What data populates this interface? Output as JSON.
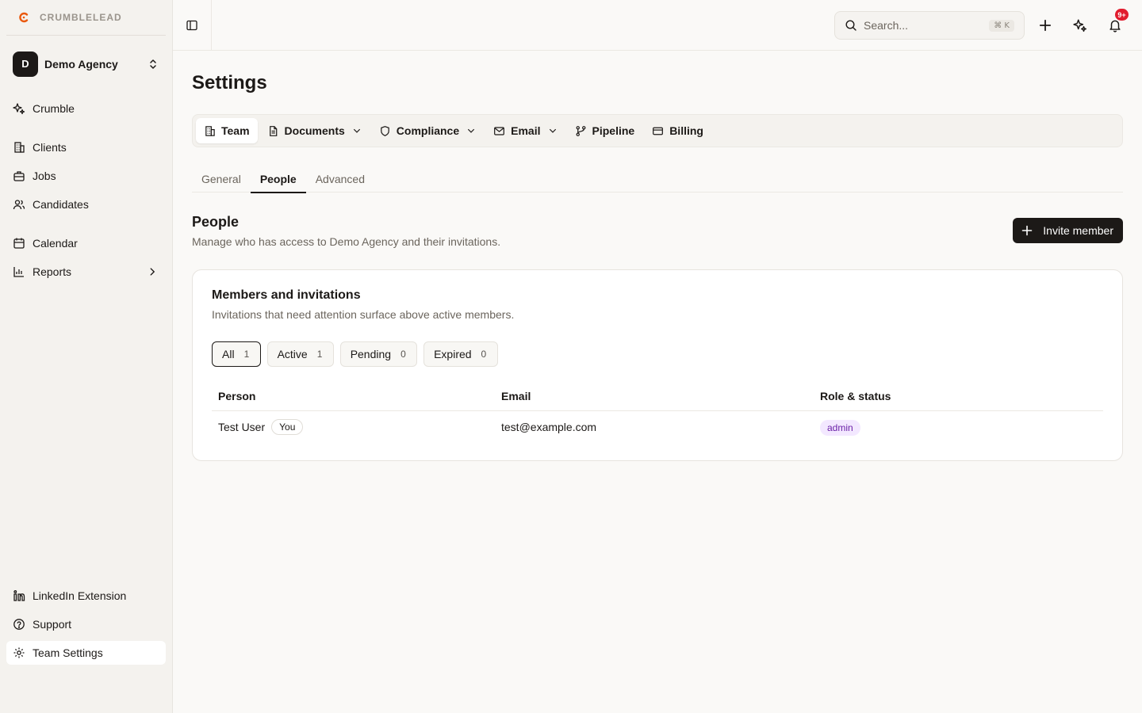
{
  "brand": {
    "name": "CRUMBLELEAD",
    "accent": "#ea580c"
  },
  "workspace": {
    "initial": "D",
    "name": "Demo Agency"
  },
  "sidebar": {
    "items": [
      {
        "label": "Crumble",
        "icon": "sparkles-icon"
      },
      {
        "label": "Clients",
        "icon": "building-icon"
      },
      {
        "label": "Jobs",
        "icon": "briefcase-icon"
      },
      {
        "label": "Candidates",
        "icon": "users-icon"
      },
      {
        "label": "Calendar",
        "icon": "calendar-icon"
      },
      {
        "label": "Reports",
        "icon": "bar-chart-icon"
      }
    ],
    "footer": [
      {
        "label": "LinkedIn Extension",
        "icon": "linkedin-icon"
      },
      {
        "label": "Support",
        "icon": "help-circle-icon"
      },
      {
        "label": "Team Settings",
        "icon": "gear-icon"
      }
    ]
  },
  "topbar": {
    "search_placeholder": "Search...",
    "shortcut": "⌘ K",
    "notif_count": "9+"
  },
  "page": {
    "title": "Settings"
  },
  "section_tabs": [
    {
      "label": "Team",
      "active": true
    },
    {
      "label": "Documents",
      "dropdown": true
    },
    {
      "label": "Compliance",
      "dropdown": true
    },
    {
      "label": "Email",
      "dropdown": true
    },
    {
      "label": "Pipeline"
    },
    {
      "label": "Billing"
    }
  ],
  "sub_tabs": [
    "General",
    "People",
    "Advanced"
  ],
  "people": {
    "title": "People",
    "description": "Manage who has access to Demo Agency and their invitations.",
    "invite_label": "Invite member"
  },
  "card": {
    "title": "Members and invitations",
    "description": "Invitations that need attention surface above active members.",
    "filters": [
      {
        "label": "All",
        "count": "1"
      },
      {
        "label": "Active",
        "count": "1"
      },
      {
        "label": "Pending",
        "count": "0"
      },
      {
        "label": "Expired",
        "count": "0"
      }
    ],
    "columns": [
      "Person",
      "Email",
      "Role & status"
    ],
    "rows": [
      {
        "name": "Test User",
        "badge": "You",
        "email": "test@example.com",
        "role": "admin"
      }
    ]
  }
}
